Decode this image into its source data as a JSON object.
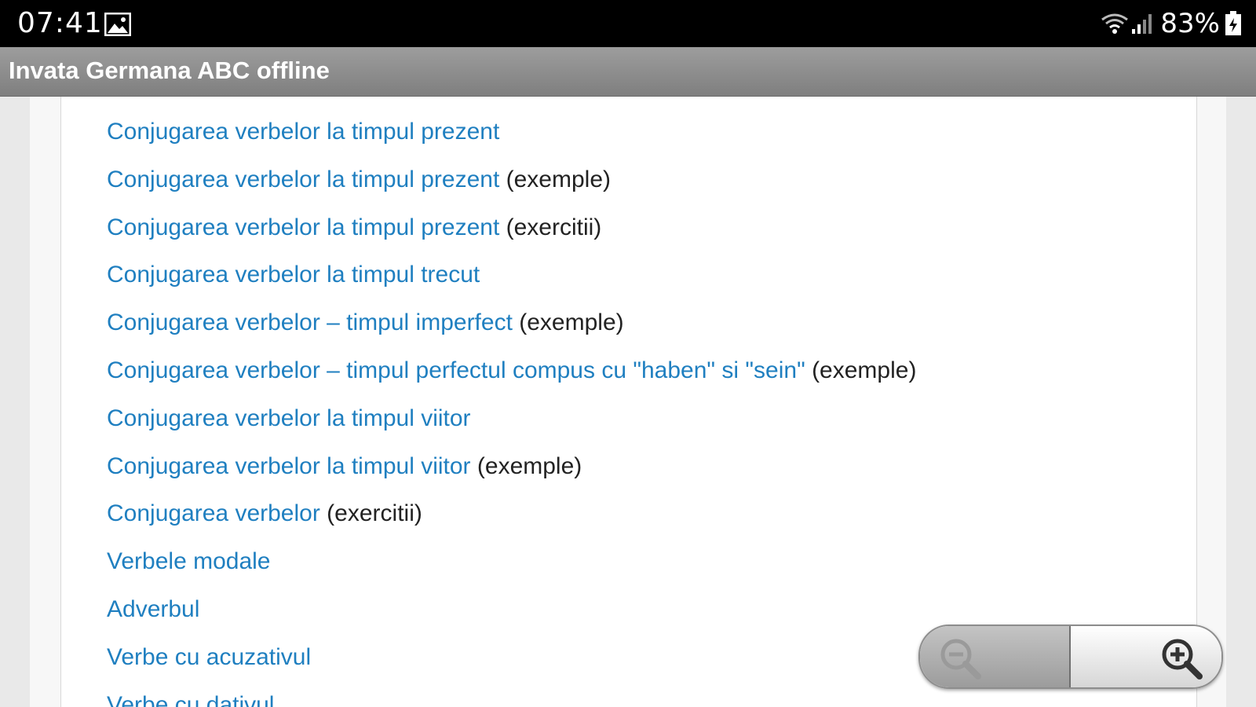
{
  "status_bar": {
    "time": "07:41",
    "battery_percent": "83%",
    "icons": [
      "image-icon",
      "wifi-icon",
      "signal-icon",
      "battery-icon"
    ]
  },
  "app_bar": {
    "title": "Invata Germana ABC offline"
  },
  "links": [
    {
      "text": "Conjugarea verbelor la timpul prezent",
      "suffix": ""
    },
    {
      "text": "Conjugarea verbelor la timpul prezent",
      "suffix": " (exemple)"
    },
    {
      "text": "Conjugarea verbelor la timpul prezent",
      "suffix": " (exercitii)"
    },
    {
      "text": "Conjugarea verbelor la timpul trecut",
      "suffix": ""
    },
    {
      "text": "Conjugarea verbelor – timpul imperfect",
      "suffix": " (exemple)"
    },
    {
      "text": "Conjugarea verbelor – timpul perfectul compus cu \"haben\" si \"sein\"",
      "suffix": " (exemple)"
    },
    {
      "text": "Conjugarea verbelor la timpul viitor",
      "suffix": ""
    },
    {
      "text": "Conjugarea verbelor la timpul viitor",
      "suffix": " (exemple)"
    },
    {
      "text": "Conjugarea verbelor",
      "suffix": " (exercitii)"
    },
    {
      "text": "Verbele modale",
      "suffix": ""
    },
    {
      "text": "Adverbul",
      "suffix": ""
    },
    {
      "text": "Verbe cu acuzativul",
      "suffix": ""
    },
    {
      "text": "Verbe cu dativul",
      "suffix": ""
    }
  ],
  "zoom": {
    "out_icon": "zoom-out-icon",
    "in_icon": "zoom-in-icon"
  },
  "colors": {
    "link": "#1f7fc0",
    "app_bar": "#8a8a8a",
    "status_bar": "#000000"
  }
}
